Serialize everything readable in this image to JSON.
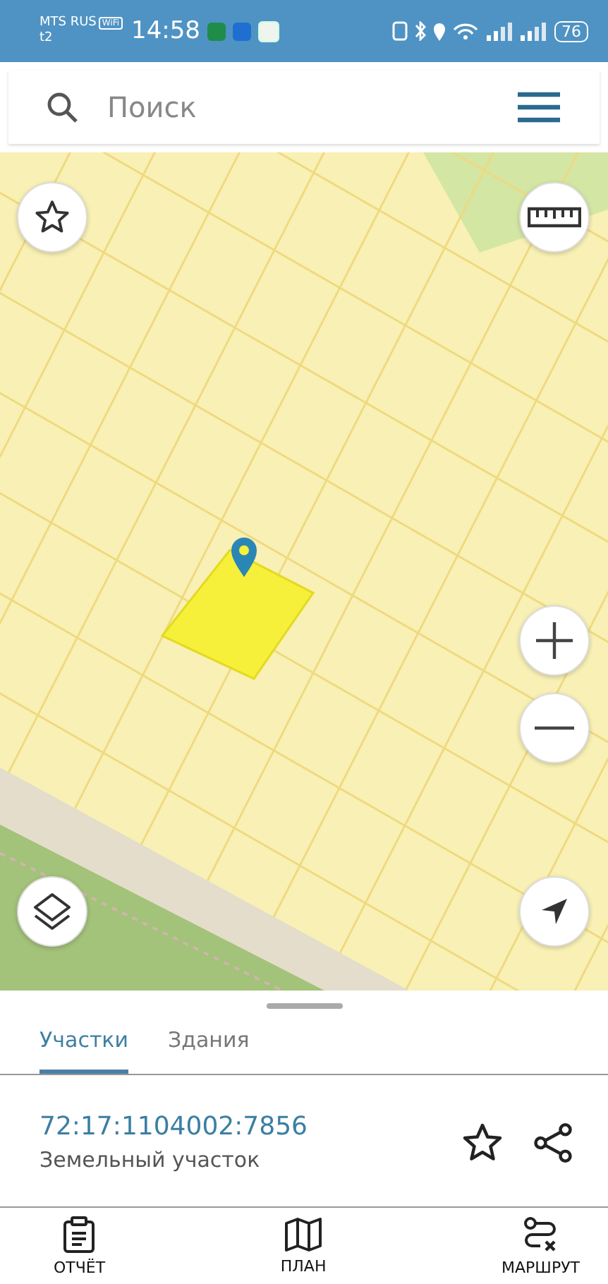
{
  "status_bar": {
    "carrier": "MTS RUS",
    "network_badge": "WiFi",
    "sim": "t2",
    "time": "14:58",
    "battery": "76"
  },
  "search": {
    "placeholder": "Поиск"
  },
  "tabs": [
    {
      "label": "Участки",
      "selected": true
    },
    {
      "label": "Здания",
      "selected": false
    }
  ],
  "parcel": {
    "number": "72:17:1104002:7856",
    "type": "Земельный участок"
  },
  "bottom_nav": [
    {
      "label": "ОТЧЁТ"
    },
    {
      "label": "ПЛАН"
    },
    {
      "label": "МАРШРУТ"
    }
  ]
}
